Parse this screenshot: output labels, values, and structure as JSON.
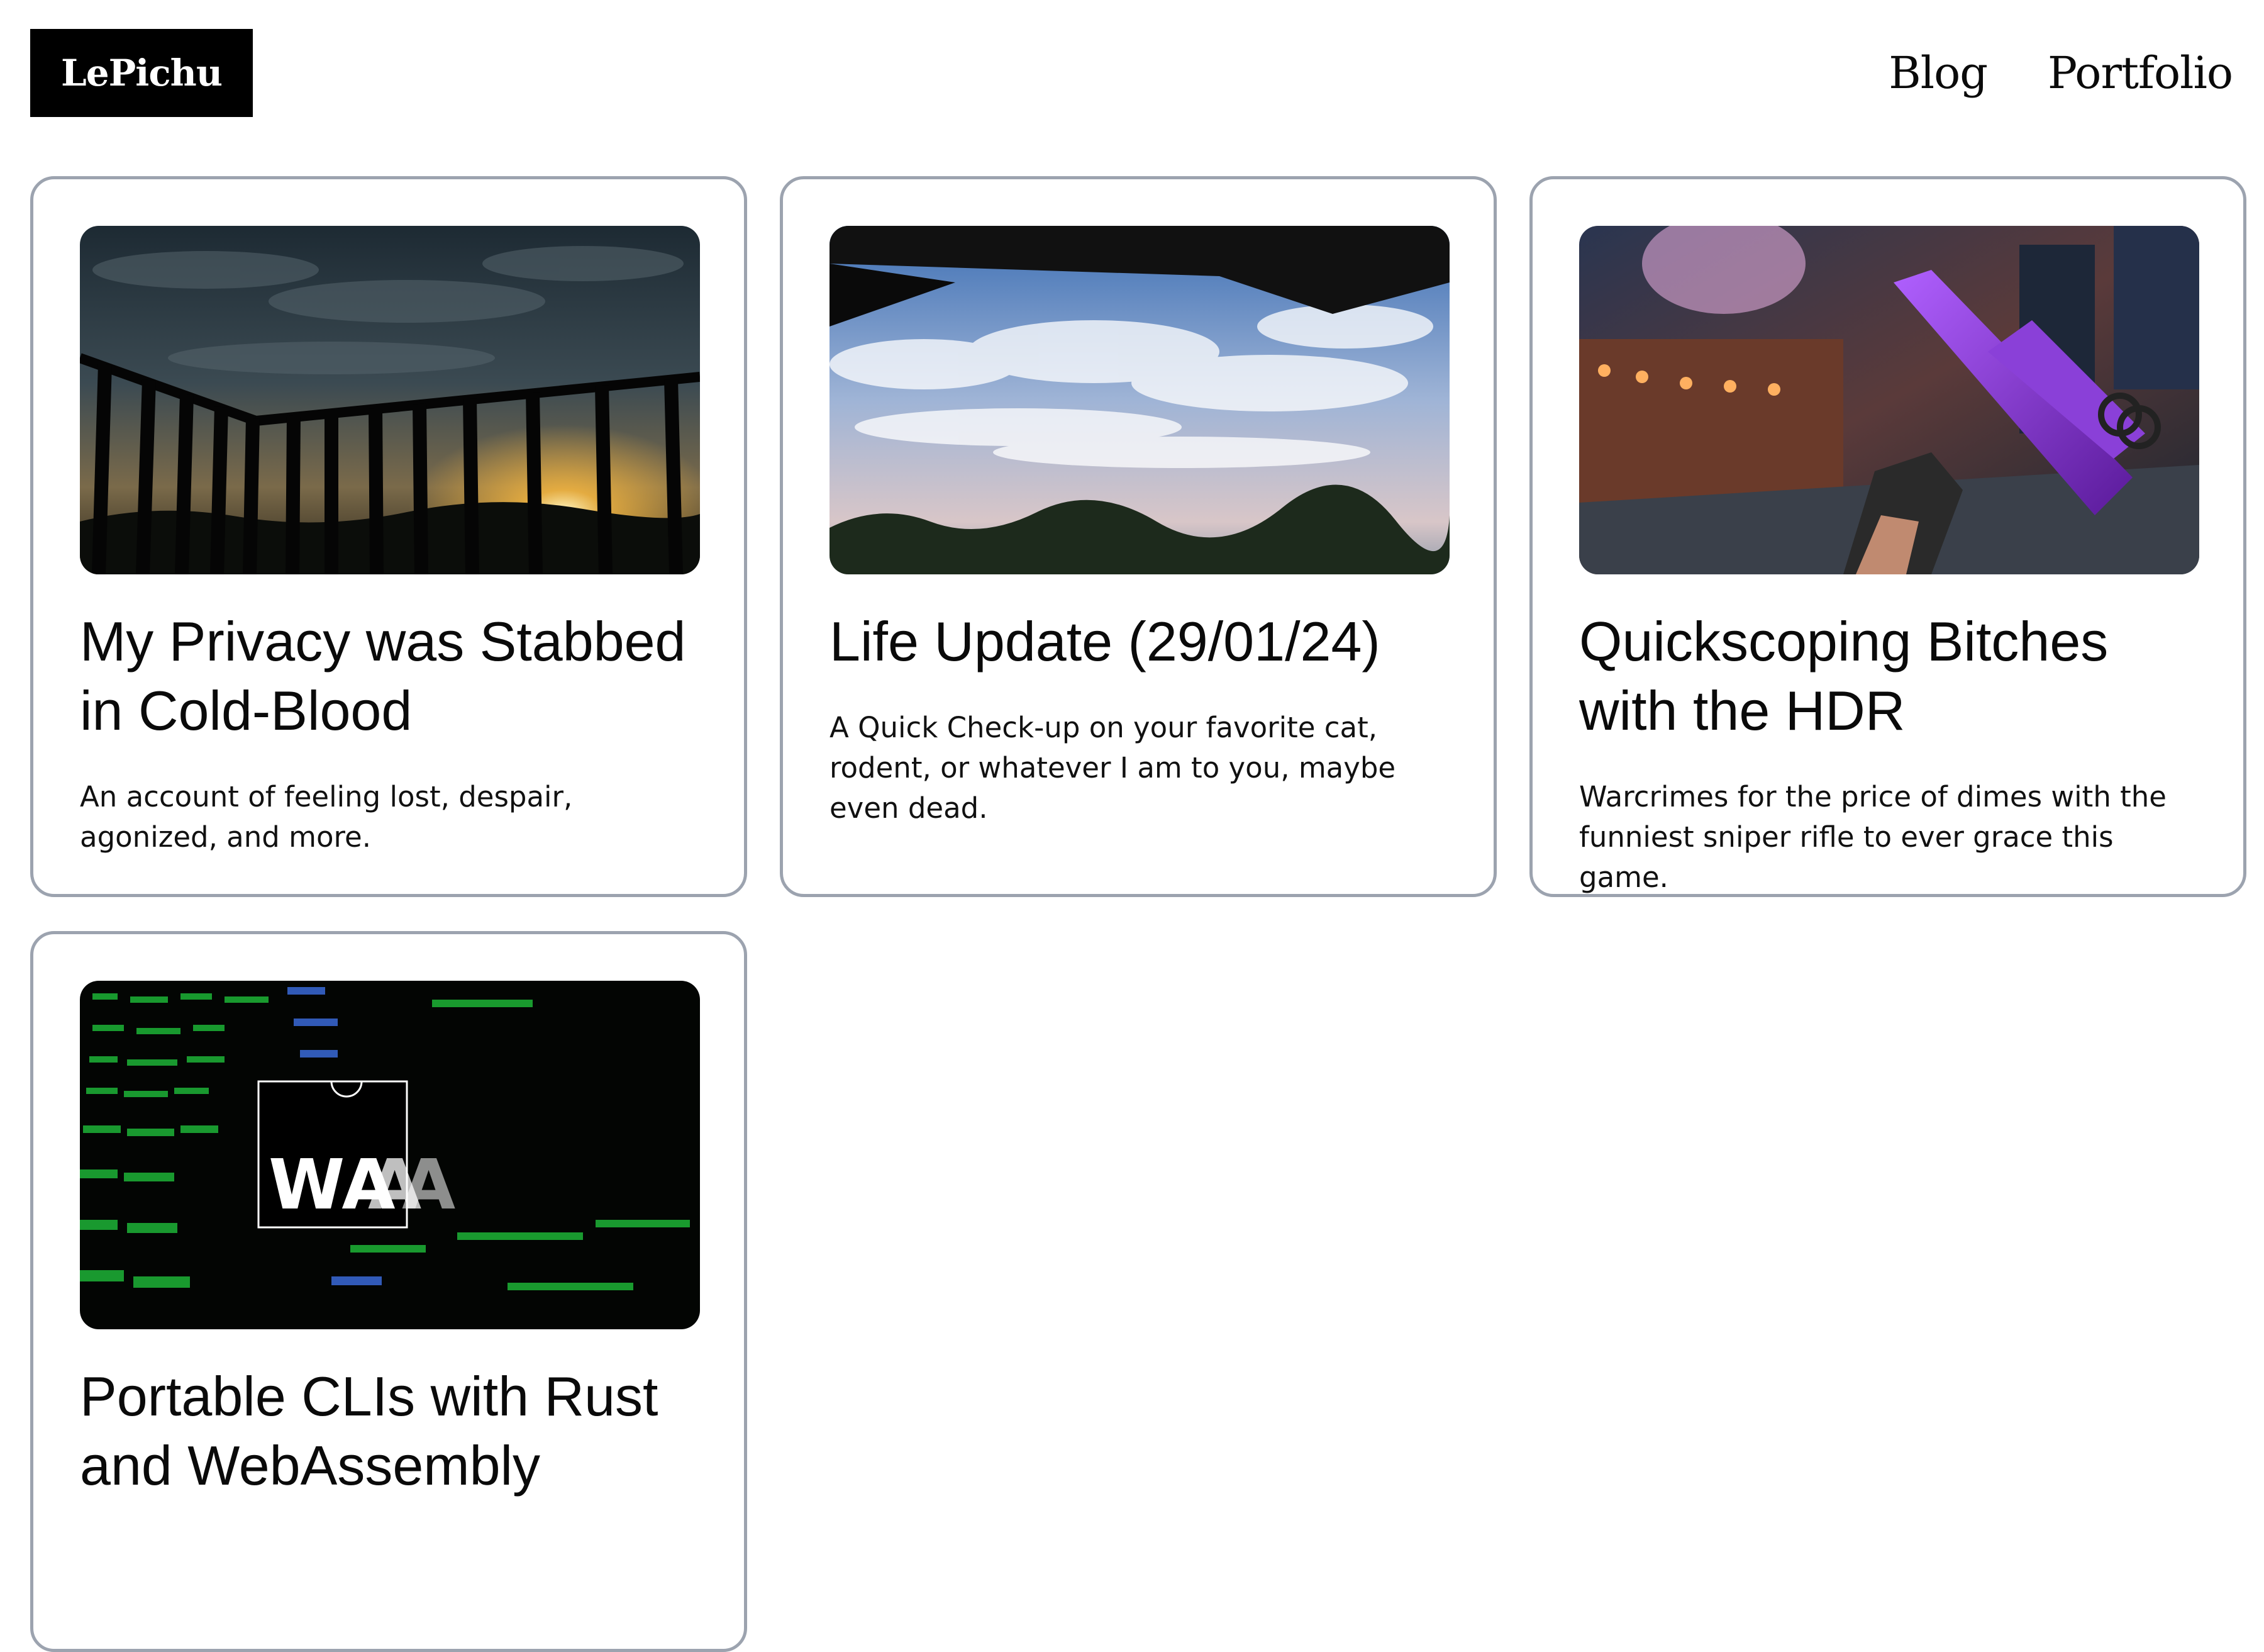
{
  "header": {
    "logo": "LePichu",
    "nav": [
      {
        "label": "Blog"
      },
      {
        "label": "Portfolio"
      }
    ]
  },
  "posts": [
    {
      "title": "My Privacy was Stabbed in Cold-Blood",
      "description": "An account of feeling lost, despair, agonized, and more.",
      "image_icon": "sunset-balcony-image"
    },
    {
      "title": "Life Update (29/01/24)",
      "description": "A Quick Check-up on your favorite cat, rodent, or whatever I am to you, maybe even dead.",
      "image_icon": "sky-clouds-image"
    },
    {
      "title": "Quickscoping Bitches with the HDR",
      "description": "Warcrimes for the price of dimes with the funniest sniper rifle to ever grace this game.",
      "image_icon": "game-sniper-image"
    },
    {
      "title": "Portable CLIs with Rust and WebAssembly",
      "description": "",
      "image_icon": "wasm-terminal-image",
      "image_text": "WA"
    }
  ]
}
